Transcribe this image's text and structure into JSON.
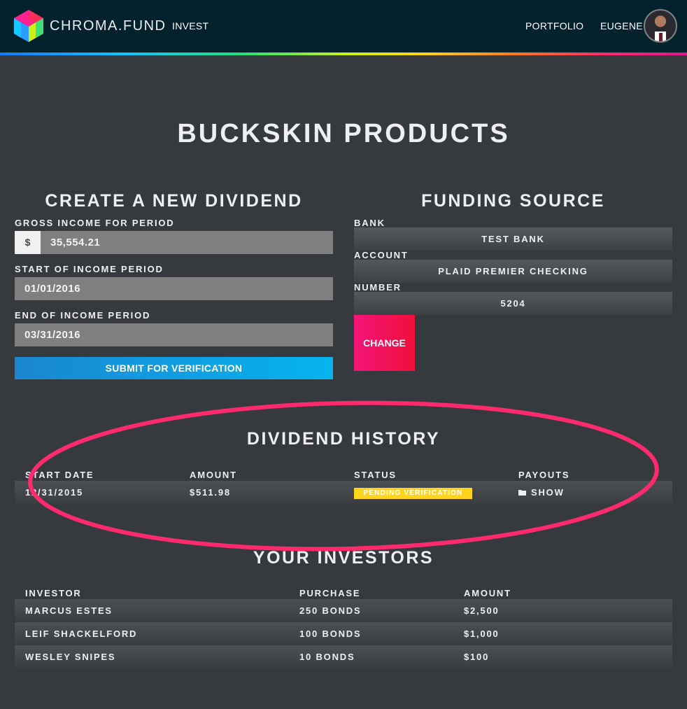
{
  "header": {
    "brand": "CHROMA.FUND",
    "nav_invest": "INVEST",
    "nav_portfolio": "PORTFOLIO",
    "user_name": "EUGENE",
    "rainbow_colors": [
      "#1877ff",
      "#12c6ff",
      "#23e07a",
      "#c8f21a",
      "#ffd21a",
      "#ff7a1a",
      "#ff2a6d",
      "#e3148c"
    ]
  },
  "page": {
    "title": "BUCKSKIN PRODUCTS"
  },
  "new_dividend": {
    "title": "CREATE A NEW DIVIDEND",
    "gross_label": "GROSS INCOME FOR PERIOD",
    "currency_symbol": "$",
    "gross_value": "35,554.21",
    "start_label": "START OF INCOME PERIOD",
    "start_value": "01/01/2016",
    "end_label": "END OF INCOME PERIOD",
    "end_value": "03/31/2016",
    "submit_label": "SUBMIT FOR VERIFICATION"
  },
  "funding_source": {
    "title": "FUNDING SOURCE",
    "bank_label": "BANK",
    "bank_value": "TEST BANK",
    "account_label": "ACCOUNT",
    "account_value": "PLAID PREMIER CHECKING",
    "number_label": "NUMBER",
    "number_value": "5204",
    "change_label": "CHANGE"
  },
  "dividend_history": {
    "title": "DIVIDEND HISTORY",
    "columns": [
      "START DATE",
      "AMOUNT",
      "STATUS",
      "PAYOUTS"
    ],
    "rows": [
      {
        "start_date": "12/31/2015",
        "amount": "$511.98",
        "status": "PENDING VERIFICATION",
        "payouts": "SHOW"
      }
    ]
  },
  "investors": {
    "title": "YOUR INVESTORS",
    "columns": [
      "INVESTOR",
      "PURCHASE",
      "AMOUNT"
    ],
    "rows": [
      {
        "investor": "MARCUS ESTES",
        "purchase": "250 BONDS",
        "amount": "$2,500"
      },
      {
        "investor": "LEIF SHACKELFORD",
        "purchase": "100 BONDS",
        "amount": "$1,000"
      },
      {
        "investor": "WESLEY SNIPES",
        "purchase": "10 BONDS",
        "amount": "$100"
      }
    ]
  },
  "colors": {
    "background": "#363a3f",
    "topbar": "#04222c",
    "submit": "#0aa8ec",
    "change": "#f5124f",
    "status_badge": "#ffd51c",
    "annotation_oval": "#ff2a6d"
  }
}
